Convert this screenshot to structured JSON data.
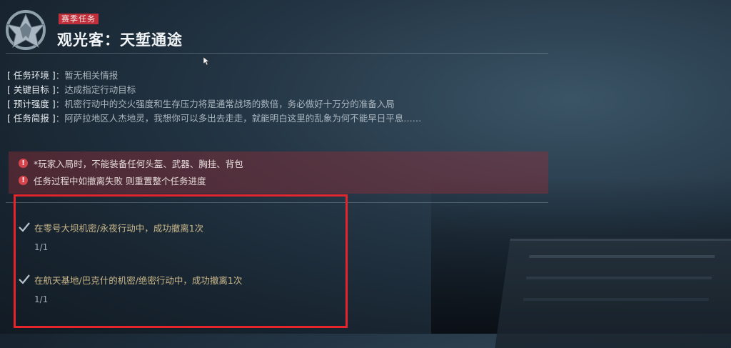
{
  "badge": "赛季任务",
  "title": "观光客：天堑通途",
  "info": [
    {
      "label": "[ 任务环境 ]",
      "sep": "：",
      "value": "暂无相关情报"
    },
    {
      "label": "[ 关键目标 ]",
      "sep": "：",
      "value": "达成指定行动目标"
    },
    {
      "label": "[ 预计强度 ]",
      "sep": "：",
      "value": "机密行动中的交火强度和生存压力将是通常战场的数倍，务必做好十万分的准备入局"
    },
    {
      "label": "[ 任务简报 ]",
      "sep": "：",
      "value": "阿萨拉地区人杰地灵，我想你可以多出去走走，就能明白这里的乱象为何不能早日平息……"
    }
  ],
  "warnings": [
    "*玩家入局时，不能装备任何头盔、武器、胸挂、背包",
    "任务过程中如撤离失败 则重置整个任务进度"
  ],
  "objectives": [
    {
      "text": "在零号大坝机密/永夜行动中，成功撤离1次",
      "progress": "1/1",
      "done": true
    },
    {
      "text": "在航天基地/巴克什的机密/绝密行动中，成功撤离1次",
      "progress": "1/1",
      "done": true
    }
  ],
  "colors": {
    "badge_bg": "#c0303a",
    "warning_bg": "#962d37",
    "objective_text": "#cbb98b",
    "highlight_frame": "#e5242c"
  },
  "icons": {
    "emblem": "eagle-shield-emblem-icon",
    "warning": "exclamation-circle-icon",
    "check": "checkmark-icon",
    "cursor": "mouse-pointer-icon"
  }
}
